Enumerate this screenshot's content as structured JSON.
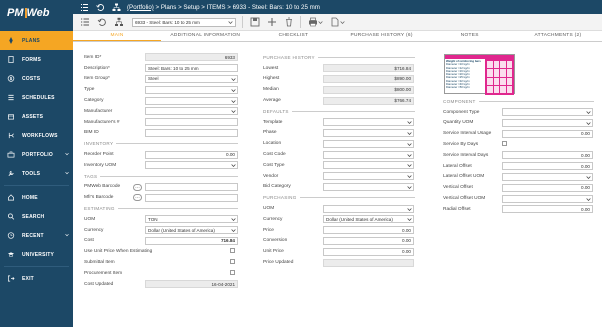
{
  "sidebar": {
    "logo_pm": "PM",
    "logo_web": "Web",
    "items": [
      {
        "label": "PLANS",
        "icon": "rocket-icon"
      },
      {
        "label": "FORMS",
        "icon": "document-icon"
      },
      {
        "label": "COSTS",
        "icon": "dollar-icon"
      },
      {
        "label": "SCHEDULES",
        "icon": "list-icon"
      },
      {
        "label": "ASSETS",
        "icon": "box-icon"
      },
      {
        "label": "WORKFLOWS",
        "icon": "branch-icon"
      },
      {
        "label": "PORTFOLIO",
        "icon": "briefcase-icon"
      },
      {
        "label": "TOOLS",
        "icon": "wrench-icon"
      },
      {
        "label": "HOME",
        "icon": "home-icon"
      },
      {
        "label": "SEARCH",
        "icon": "search-icon"
      },
      {
        "label": "RECENT",
        "icon": "clock-icon"
      },
      {
        "label": "UNIVERSITY",
        "icon": "graduation-icon"
      },
      {
        "label": "EXIT",
        "icon": "exit-icon"
      }
    ]
  },
  "breadcrumb": {
    "link": "(Portfolio)",
    "rest": " > Plans > Setup > ITEMS > 6933 - Steel: Bars: 10 to 25 mm"
  },
  "record_select": "6933 - Steel: Bars: 10 to 25 mm",
  "tabs": [
    "MAIN",
    "ADDITIONAL INFORMATION",
    "CHECKLIST",
    "PURCHASE HISTORY (6)",
    "NOTES",
    "ATTACHMENTS (2)"
  ],
  "left": {
    "item_id_label": "Item ID*",
    "item_id": "6933",
    "description_label": "Description*",
    "description": "Steel: Bars: 10 to 25 mm",
    "item_group_label": "Item Group*",
    "item_group": "Steel",
    "type_label": "Type",
    "type": "",
    "category_label": "Category",
    "category": "",
    "manufacturer_label": "Manufacturer",
    "manufacturer": "",
    "manufacturer_no_label": "Manufacturer's #",
    "manufacturer_no": "",
    "bim_id_label": "BIM ID",
    "bim_id": "",
    "inventory_header": "INVENTORY",
    "reorder_point_label": "Reorder Point",
    "reorder_point": "0.00",
    "inventory_uom_label": "Inventory UOM",
    "inventory_uom": "",
    "tags_header": "TAGS",
    "pmweb_barcode_label": "PMWeb Barcode",
    "pmweb_barcode": "",
    "mfr_barcode_label": "Mfr's Barcode",
    "mfr_barcode": "",
    "estimating_header": "ESTIMATING",
    "uom_label": "UOM",
    "uom": "TON",
    "currency_label": "Currency",
    "currency": "Dollar (United States of America)",
    "cost_label": "Cost",
    "cost": "716.84",
    "use_unit_price_label": "Use Unit Price When Estimating",
    "submittal_item_label": "Submittal Item",
    "procurement_item_label": "Procurement Item",
    "cost_updated_label": "Cost Updated",
    "cost_updated": "16-04-2021"
  },
  "middle": {
    "purchase_history_header": "PURCHASE HISTORY",
    "lowest_label": "Lowest",
    "lowest": "$716.84",
    "highest_label": "Highest",
    "highest": "$890.00",
    "median_label": "Median",
    "median": "$800.00",
    "average_label": "Average",
    "average": "$766.74",
    "defaults_header": "DEFAULTS",
    "template_label": "Template",
    "template": "",
    "phase_label": "Phase",
    "phase": "",
    "location_label": "Location",
    "location": "",
    "cost_code_label": "Cost Code",
    "cost_code": "",
    "cost_type_label": "Cost Type",
    "cost_type": "",
    "vendor_label": "Vendor",
    "vendor": "",
    "bid_category_label": "Bid Category",
    "bid_category": "",
    "purchasing_header": "PURCHASING",
    "uom_label": "UOM",
    "uom": "",
    "currency_label": "Currency",
    "currency": "Dollar (United States of America)",
    "price_label": "Price",
    "price": "0.00",
    "conversion_label": "Conversion",
    "conversion": "0.00",
    "unit_price_label": "Unit Price",
    "unit_price": "0.00",
    "price_updated_label": "Price Updated",
    "price_updated": ""
  },
  "right": {
    "image_title": "Weight of reinforcing bars",
    "image_lines": [
      "Diameter =10 kg/m",
      "Diameter =12 kg/m",
      "Diameter =16 kg/m",
      "Diameter =20 kg/m",
      "Diameter =25 kg/m",
      "Diameter =32 kg/m",
      "Diameter =40 kg/m",
      "Diameter =50 kg/m"
    ],
    "component_header": "COMPONENT",
    "component_type_label": "Component Type",
    "component_type": "",
    "quantity_uom_label": "Quantity UOM",
    "quantity_uom": "",
    "service_interval_usage_label": "Service Interval Usage",
    "service_interval_usage": "0.00",
    "service_by_days_label": "Service By Days",
    "service_interval_days_label": "Service Interval Days",
    "service_interval_days": "0.00",
    "lateral_offset_label": "Lateral Offset",
    "lateral_offset": "0.00",
    "lateral_offset_uom_label": "Lateral Offset UOM",
    "lateral_offset_uom": "",
    "vertical_offset_label": "Vertical Offset",
    "vertical_offset": "0.00",
    "vertical_offset_uom_label": "Vertical Offset UOM",
    "vertical_offset_uom": "",
    "radial_offset_label": "Radial Offset",
    "radial_offset": "0.00"
  },
  "colors": {
    "sidebar": "#1c4866",
    "accent": "#f5a623",
    "image_magenta": "#e0278e"
  }
}
